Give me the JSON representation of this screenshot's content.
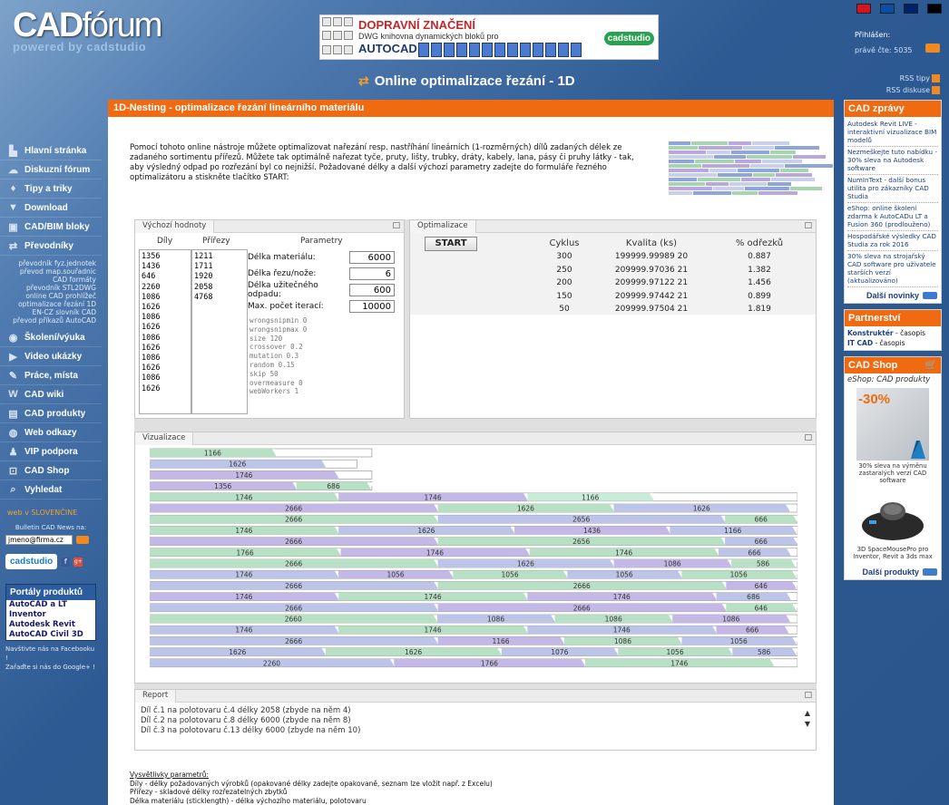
{
  "header": {
    "logo_main": "CAD",
    "logo_main2": "fórum",
    "logo_sub": "powered by cadstudio",
    "banner": {
      "line1": "DOPRAVNÍ ZNAČENÍ",
      "line2": "DWG knihovna dynamických bloků pro",
      "line3": "AUTOCAD",
      "brand": "cadstudio"
    },
    "login_label": "Přihlášen:",
    "online_text": "právě čte: 5035",
    "page_title": "Online optimalizace řezání - 1D",
    "rss_tips": "RSS tipy",
    "rss_discussion": "RSS diskuse",
    "flags": [
      {
        "name": "cz",
        "color": "#d7141a"
      },
      {
        "name": "sk",
        "color": "#0b4ea2"
      },
      {
        "name": "en",
        "color": "#012169"
      },
      {
        "name": "de",
        "color": "#000000"
      }
    ]
  },
  "sidebar": {
    "items": [
      {
        "label": "Hlavní stránka",
        "icon": "home-icon"
      },
      {
        "label": "Diskuzní fórum",
        "icon": "forum-icon"
      },
      {
        "label": "Tipy a triky",
        "icon": "bulb-icon"
      },
      {
        "label": "Download",
        "icon": "download-icon"
      },
      {
        "label": "CAD/BIM bloky",
        "icon": "blocks-icon"
      },
      {
        "label": "Převodníky",
        "icon": "convert-icon"
      }
    ],
    "subitems": [
      "převodník fyz.jednotek",
      "převod map.souřadnic",
      "CAD formáty",
      "převodník STL2DWG",
      "online CAD prohlížeč",
      "optimalizace řezání 1D",
      "EN-CZ slovník CAD",
      "převod příkazů AutoCAD"
    ],
    "items2": [
      {
        "label": "Školení/výuka",
        "icon": "school-icon"
      },
      {
        "label": "Video ukázky",
        "icon": "video-icon"
      },
      {
        "label": "Práce, místa",
        "icon": "work-icon"
      },
      {
        "label": "CAD wiki",
        "icon": "wiki-icon"
      },
      {
        "label": "CAD produkty",
        "icon": "products-icon"
      },
      {
        "label": "Web odkazy",
        "icon": "globe-icon"
      },
      {
        "label": "VIP podpora",
        "icon": "vip-icon"
      },
      {
        "label": "CAD Shop",
        "icon": "cart-icon"
      },
      {
        "label": "Vyhledat",
        "icon": "search-icon"
      }
    ],
    "slovak": "web v SLOVENČINE",
    "bulletin": "Bulletin CAD News na:",
    "email_value": "jmeno@firma.cz",
    "cadstudio": "cadstudio",
    "portaly_title": "Portály produktů",
    "portaly": [
      "AutoCAD a LT",
      "Inventor",
      "Autodesk Revit",
      "AutoCAD Civil 3D"
    ],
    "social1": "Navštivte nás na Facebooku !",
    "social2": "Zařaďte si nás do Google+ !"
  },
  "main": {
    "head": "1D-Nesting - optimalizace řezání lineárního materiálu",
    "intro": "Pomocí tohoto online nástroje můžete optimalizovat nařezání resp. nastříhání lineárních (1-rozměrných) dílů zadaných délek ze zadaného sortimentu přířezů. Můžete tak optimálně nařezat tyče, pruty, lišty, trubky, dráty, kabely, lana, pásy či pruhy látky - tak, aby výsledný odpad po rozřezání byl co nejnižší. Požadované délky a další výchozí parametry zadejte do formuláře řezného optimalizátoru a stiskněte tlačítko START:",
    "vh_tab": "Výchozí hodnoty",
    "col_dily": "Díly",
    "col_prirezy": "Přířezy",
    "col_params": "Parametry",
    "dily": "1356\n1436\n646\n2260\n1086\n1626\n1086\n1626\n1086\n1626\n1086\n1626\n1086\n1626",
    "prirezy": "1211\n1711\n1920\n2058\n4768",
    "form": [
      {
        "label": "Délka materiálu:",
        "value": "6000"
      },
      {
        "label": "Délka řezu/nože:",
        "value": "6"
      },
      {
        "label": "Délka užitečného odpadu:",
        "value": "600"
      },
      {
        "label": "Max. počet iterací:",
        "value": "10000"
      }
    ],
    "params_text": "wrongsnipmin 0\nwrongsnipmax 0\nsize 120\ncrossover 0.2\nmutation 0.3\nrandom 0.15\nskip 50\novermeasure 0\nwebWorkers 1",
    "opt_tab": "Optimalizace",
    "start": "START",
    "table_headers": [
      "Cyklus",
      "Kvalita (ks)",
      "% odřezků"
    ],
    "table_rows": [
      [
        "300",
        "199999.99989 20",
        "0.887"
      ],
      [
        "250",
        "209999.97036 21",
        "1.382"
      ],
      [
        "200",
        "209999.97122 21",
        "1.456"
      ],
      [
        "150",
        "209999.97442 21",
        "0.899"
      ],
      [
        "50",
        "209999.97504 21",
        "1.819"
      ]
    ],
    "viz_tab": "Vizualizace",
    "report_tab": "Report",
    "report_lines": [
      "Díl č.1 na polotovaru č.4 délky 2058 (zbyde na něm 4)",
      "Díl č.2 na polotovaru č.8 délky 6000 (zbyde na něm 8)",
      "Díl č.3 na polotovaru č.13 délky 6000 (zbyde na něm 10)"
    ],
    "legend_head": "Vysvětlivky parametrů:",
    "legend_lines": [
      "Díly - délky požadovaných výrobků (opakované délky zadejte opakovaně, seznam lze vložit např. z Excelu)",
      "Přířezy - skladové délky rozřezatelných zbytků",
      "Délka materiálu (sticklength) - délka výchozího materiálu, polotovaru"
    ]
  },
  "viz_rows": [
    {
      "stock": 2058,
      "parts": [
        [
          1166,
          "#b8e0c4"
        ]
      ]
    },
    {
      "stock": 1920,
      "parts": [
        [
          1626,
          "#bcc4e8"
        ]
      ]
    },
    {
      "stock": 2058,
      "parts": [
        [
          1746,
          "#c4b8e6"
        ]
      ]
    },
    {
      "stock": 2058,
      "parts": [
        [
          1356,
          "#c4b8e6"
        ],
        [
          686,
          "#b8e0c4"
        ]
      ]
    },
    {
      "stock": 6000,
      "parts": [
        [
          1746,
          "#b8e0c4"
        ],
        [
          1746,
          "#c4b8e6"
        ],
        [
          1166,
          "#c8ecd8"
        ]
      ]
    },
    {
      "stock": 6000,
      "parts": [
        [
          2666,
          "#c4b8e6"
        ],
        [
          1626,
          "#b8e0c4"
        ],
        [
          1626,
          "#bcc4e8"
        ]
      ]
    },
    {
      "stock": 6000,
      "parts": [
        [
          2666,
          "#b8e0c4"
        ],
        [
          2656,
          "#bcc4e8"
        ],
        [
          666,
          "#b8e0c4"
        ]
      ]
    },
    {
      "stock": 6000,
      "parts": [
        [
          1746,
          "#b8e0c4"
        ],
        [
          1626,
          "#bcc4e8"
        ],
        [
          1436,
          "#c4b8e6"
        ],
        [
          1166,
          "#bcc4e8"
        ]
      ]
    },
    {
      "stock": 6000,
      "parts": [
        [
          2666,
          "#c4b8e6"
        ],
        [
          2656,
          "#b8e0c4"
        ],
        [
          666,
          "#bcc4e8"
        ]
      ]
    },
    {
      "stock": 6000,
      "parts": [
        [
          1766,
          "#b8e0c4"
        ],
        [
          1746,
          "#c4b8e6"
        ],
        [
          1746,
          "#b8e0c4"
        ],
        [
          666,
          "#bcc4e8"
        ]
      ]
    },
    {
      "stock": 6000,
      "parts": [
        [
          2666,
          "#b8e0c4"
        ],
        [
          1626,
          "#bcc4e8"
        ],
        [
          1086,
          "#c4b8e6"
        ],
        [
          586,
          "#b8e0c4"
        ]
      ]
    },
    {
      "stock": 6000,
      "parts": [
        [
          1746,
          "#bcc4e8"
        ],
        [
          1056,
          "#c4b8e6"
        ],
        [
          1056,
          "#b8e0c4"
        ],
        [
          1056,
          "#bcc4e8"
        ],
        [
          1056,
          "#b8e0c4"
        ]
      ]
    },
    {
      "stock": 6000,
      "parts": [
        [
          2666,
          "#bcc4e8"
        ],
        [
          2666,
          "#b8e0c4"
        ],
        [
          646,
          "#c4b8e6"
        ]
      ]
    },
    {
      "stock": 6000,
      "parts": [
        [
          1746,
          "#c4b8e6"
        ],
        [
          1746,
          "#b8e0c4"
        ],
        [
          1746,
          "#c4b8e6"
        ],
        [
          686,
          "#bcc4e8"
        ]
      ]
    },
    {
      "stock": 6000,
      "parts": [
        [
          2666,
          "#bcc4e8"
        ],
        [
          2666,
          "#c4b8e6"
        ],
        [
          646,
          "#b8e0c4"
        ]
      ]
    },
    {
      "stock": 6000,
      "parts": [
        [
          2660,
          "#b8e0c4"
        ],
        [
          1086,
          "#bcc4e8"
        ],
        [
          1086,
          "#b8e0c4"
        ],
        [
          1086,
          "#c4b8e6"
        ]
      ]
    },
    {
      "stock": 6000,
      "parts": [
        [
          1746,
          "#bcc4e8"
        ],
        [
          1746,
          "#b8e0c4"
        ],
        [
          1746,
          "#bcc4e8"
        ],
        [
          666,
          "#c4b8e6"
        ]
      ]
    },
    {
      "stock": 6000,
      "parts": [
        [
          2666,
          "#bcc4e8"
        ],
        [
          1166,
          "#c4b8e6"
        ],
        [
          1086,
          "#b8e0c4"
        ],
        [
          1056,
          "#bcc4e8"
        ]
      ]
    },
    {
      "stock": 6000,
      "parts": [
        [
          1626,
          "#bcc4e8"
        ],
        [
          1626,
          "#b8e0c4"
        ],
        [
          1076,
          "#bcc4e8"
        ],
        [
          1056,
          "#b8e0c4"
        ],
        [
          586,
          "#bcc4e8"
        ]
      ]
    },
    {
      "stock": 6000,
      "parts": [
        [
          2260,
          "#bcc4e8"
        ],
        [
          1766,
          "#c4b8e6"
        ],
        [
          1746,
          "#b8e0c4"
        ]
      ]
    }
  ],
  "right": {
    "news_title": "CAD zprávy",
    "news": [
      "Autodesk Revit LIVE - interaktivní vizualizace BIM modelů",
      "Nezmeškejte tuto nabídku - 30% sleva na Autodesk software",
      "NumInText - další bonus utilita pro zákazníky CAD Studia",
      "eShop: online školení zdarma k AutoCADu LT a Fusion 360 (prodlouženo)",
      "Hospodářské výsledky CAD Studia za rok 2016",
      "30% sleva na strojařský CAD software pro uživatele starších verzí (aktualizováno)"
    ],
    "news_more": "Další novinky",
    "partner_title": "Partnerství",
    "partners": [
      [
        "Konstruktér",
        "časopis"
      ],
      [
        "IT CAD",
        "časopis"
      ]
    ],
    "shop_title": "CAD Shop",
    "shop_sub": "eShop: CAD produkty",
    "shop_pct": "-30%",
    "shop_cap1": "30% sleva na výměnu zastaralých verzí CAD software",
    "shop_cap2": "3D SpaceMousePro pro Inventor, Revit a 3ds max",
    "shop_more": "Další produkty"
  }
}
